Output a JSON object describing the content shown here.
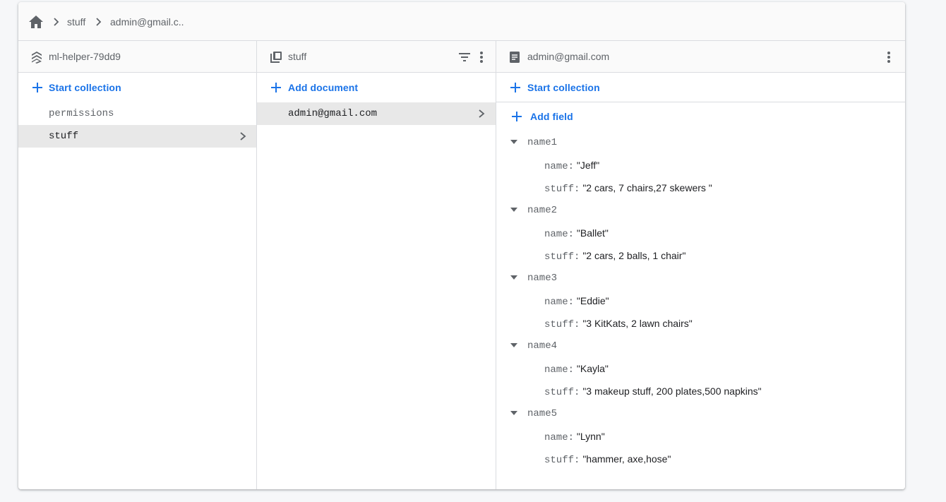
{
  "breadcrumb": {
    "home_icon": "home-icon",
    "items": [
      "stuff",
      "admin@gmail.c.."
    ]
  },
  "panels": {
    "root": {
      "title": "ml-helper-79dd9",
      "action_label": "Start collection",
      "items": [
        "permissions",
        "stuff"
      ],
      "selected": "stuff"
    },
    "collection": {
      "title": "stuff",
      "action_label": "Add document",
      "items": [
        "admin@gmail.com"
      ],
      "selected": "admin@gmail.com"
    },
    "document": {
      "title": "admin@gmail.com",
      "action_label": "Start collection",
      "add_field_label": "Add field",
      "fields": [
        {
          "key": "name1",
          "name_key": "name:",
          "name_value": "\"Jeff\"",
          "stuff_key": "stuff:",
          "stuff_value": "\"2 cars, 7 chairs,27 skewers \""
        },
        {
          "key": "name2",
          "name_key": "name:",
          "name_value": "\"Ballet\"",
          "stuff_key": "stuff:",
          "stuff_value": "\"2 cars, 2 balls, 1 chair\""
        },
        {
          "key": "name3",
          "name_key": "name:",
          "name_value": "\"Eddie\"",
          "stuff_key": "stuff:",
          "stuff_value": "\"3 KitKats, 2 lawn chairs\""
        },
        {
          "key": "name4",
          "name_key": "name:",
          "name_value": "\"Kayla\"",
          "stuff_key": "stuff:",
          "stuff_value": "\"3 makeup stuff, 200 plates,500 napkins\""
        },
        {
          "key": "name5",
          "name_key": "name:",
          "name_value": "\"Lynn\"",
          "stuff_key": "stuff:",
          "stuff_value": "\"hammer, axe,hose\""
        }
      ]
    }
  },
  "colors": {
    "accent": "#1a73e8",
    "selected_bg": "#e8e8e8",
    "muted_text": "#5f6368"
  }
}
